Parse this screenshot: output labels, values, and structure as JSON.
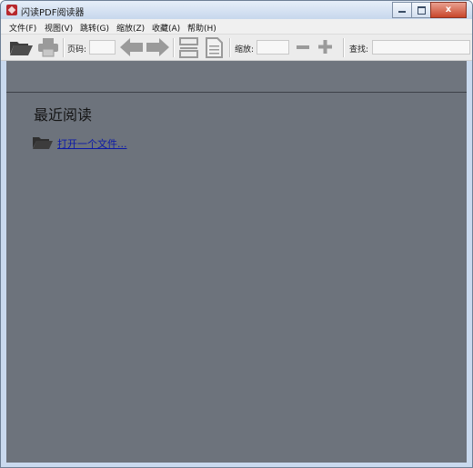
{
  "window": {
    "title": "闪读PDF阅读器",
    "close_glyph": "x"
  },
  "menu": [
    {
      "label": "文件(F)"
    },
    {
      "label": "视图(V)"
    },
    {
      "label": "跳转(G)"
    },
    {
      "label": "缩放(Z)"
    },
    {
      "label": "收藏(A)"
    },
    {
      "label": "帮助(H)"
    }
  ],
  "toolbar": {
    "page_label": "页码:",
    "page_value": "",
    "zoom_label": "缩放:",
    "zoom_value": "",
    "search_label": "查找:",
    "search_value": "",
    "icons": {
      "open": "folder-open-icon",
      "print": "printer-icon",
      "prev": "arrow-left-icon",
      "next": "arrow-right-icon",
      "fit_width": "fit-width-icon",
      "fit_page": "fit-page-icon",
      "zoom_out": "minus-icon",
      "zoom_in": "plus-icon"
    }
  },
  "main": {
    "recent_title": "最近阅读",
    "open_file_link": "打开一个文件..."
  },
  "colors": {
    "content_bg": "#6d737c",
    "link": "#0b19a8",
    "icon_disabled": "#9a9a9a",
    "icon_active": "#4d4d4d"
  }
}
